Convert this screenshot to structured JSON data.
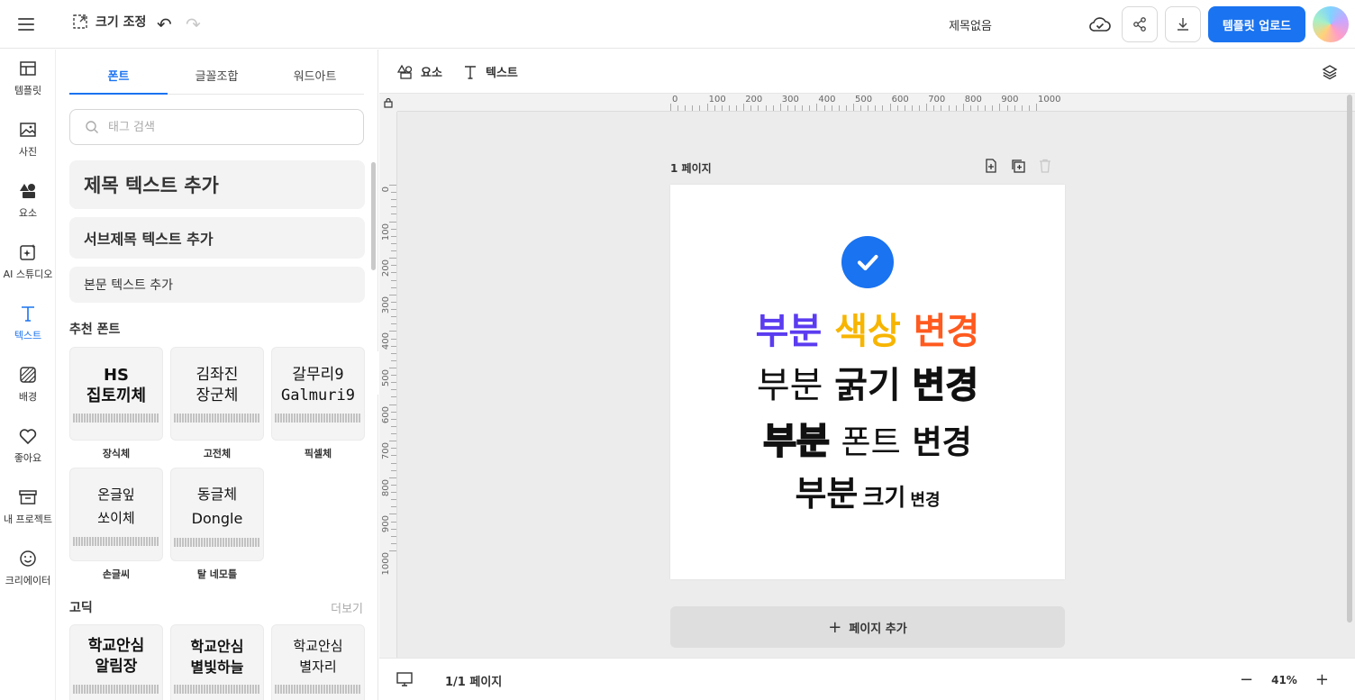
{
  "topbar": {
    "resize_label": "크기 조정",
    "doc_title": "제목없음",
    "upload_label": "템플릿 업로드"
  },
  "leftnav": [
    {
      "label": "템플릿",
      "icon": "template-icon"
    },
    {
      "label": "사진",
      "icon": "photo-icon"
    },
    {
      "label": "요소",
      "icon": "shapes-icon"
    },
    {
      "label": "AI 스튜디오",
      "icon": "ai-sparkle-icon"
    },
    {
      "label": "텍스트",
      "icon": "text-icon",
      "active": true
    },
    {
      "label": "배경",
      "icon": "background-icon"
    },
    {
      "label": "좋아요",
      "icon": "heart-icon"
    },
    {
      "label": "내 프로젝트",
      "icon": "folder-icon"
    },
    {
      "label": "크리에이터",
      "icon": "smile-icon"
    }
  ],
  "panel": {
    "tabs": [
      "폰트",
      "글꼴조합",
      "워드아트"
    ],
    "search_placeholder": "태그 검색",
    "add_title": "제목 텍스트 추가",
    "add_subtitle": "서브제목 텍스트 추가",
    "add_body": "본문 텍스트 추가",
    "recommended_title": "추천 폰트",
    "recommended": [
      {
        "sample": "HS\n집토끼체",
        "label": "장식체"
      },
      {
        "sample": "김좌진\n장군체",
        "label": "고전체"
      },
      {
        "sample": "갈무리9\nGalmuri9",
        "label": "픽셀체"
      },
      {
        "sample": "온글잎\n쏘이체",
        "label": "손글씨"
      },
      {
        "sample": "동글체\nDongle",
        "label": "탈 네모틀"
      }
    ],
    "gothic_title": "고딕",
    "more_label": "더보기",
    "gothic": [
      {
        "sample": "학교안심\n알림장"
      },
      {
        "sample": "학교안심\n별빛하늘"
      },
      {
        "sample": "학교안심\n별자리"
      }
    ]
  },
  "toolbar": {
    "elements_label": "요소",
    "text_label": "텍스트"
  },
  "ruler": {
    "h": [
      "0",
      "100",
      "200",
      "300",
      "400",
      "500",
      "600",
      "700",
      "800",
      "900",
      "1000"
    ],
    "v": [
      "0",
      "100",
      "200",
      "300",
      "400",
      "500",
      "600",
      "700",
      "800",
      "900",
      "1000"
    ]
  },
  "canvas": {
    "page_label": "1 페이지",
    "line1": [
      {
        "text": "부분",
        "color": "#5b3cf0"
      },
      {
        "text": "색상",
        "color": "#f7b500"
      },
      {
        "text": "변경",
        "color": "#ff5a1f"
      }
    ],
    "line2": [
      {
        "text": "부분"
      },
      {
        "text": "굵기"
      },
      {
        "text": "변경"
      }
    ],
    "line3": [
      {
        "text": "부분"
      },
      {
        "text": "폰트"
      },
      {
        "text": "변경"
      }
    ],
    "line4": [
      {
        "text": "부분"
      },
      {
        "text": "크기"
      },
      {
        "text": "변경"
      }
    ],
    "add_page_label": "페이지 추가"
  },
  "bottombar": {
    "page_indicator": "1/1 페이지",
    "zoom": "41%"
  },
  "colors": {
    "accent": "#1a73f0"
  }
}
